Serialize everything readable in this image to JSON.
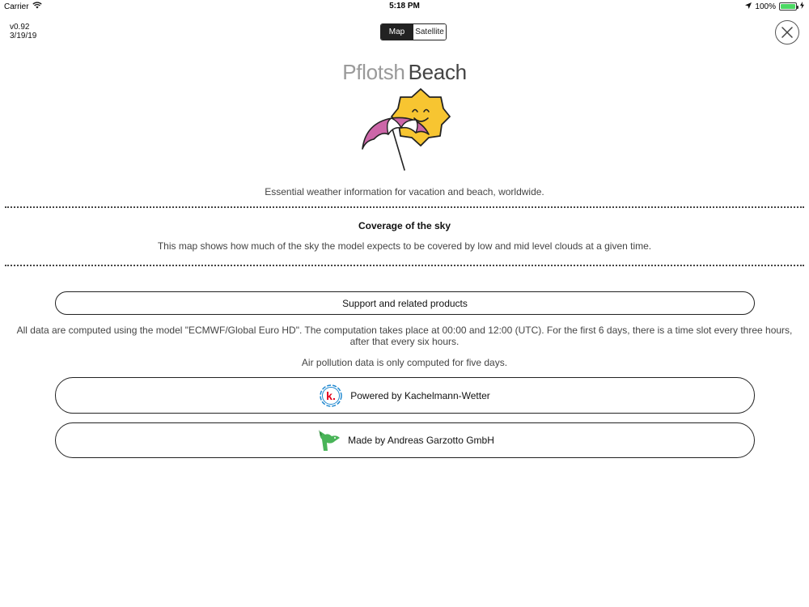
{
  "status_bar": {
    "carrier": "Carrier",
    "time": "5:18 PM",
    "battery": "100%",
    "battery_level": 1.0,
    "icons": [
      "wifi-icon",
      "location-arrow-icon",
      "battery-icon",
      "charging-bolt-icon"
    ]
  },
  "version": {
    "number": "v0.92",
    "date": "3/19/19"
  },
  "map_mode": {
    "options": [
      "Map",
      "Satellite"
    ],
    "selected": "Map"
  },
  "close_icon": "close-icon",
  "title": {
    "part1": "Pflotsh",
    "part2": "Beach"
  },
  "tagline": "Essential weather information for vacation and beach, worldwide.",
  "section": {
    "title": "Coverage of the sky",
    "description": "This map shows how much of the sky the model expects to be covered by low and mid level clouds at a given time."
  },
  "support_button": "Support and related products",
  "info_text": "All data are computed using the model \"ECMWF/Global Euro HD\". The computation takes place at 00:00 and 12:00 (UTC). For the first 6 days, there is a time slot every three hours, after that every six hours.",
  "pollution_text": "Air pollution data is only computed for five days.",
  "kachelmann_button": "Powered by Kachelmann-Wetter",
  "garzotto_button": "Made by Andreas Garzotto GmbH",
  "colors": {
    "sun": "#f7c531",
    "umbrella_pink": "#cc66a8",
    "kachelmann_red": "#e3001b",
    "kachelmann_blue": "#1e88d0",
    "garzotto_green": "#49b458",
    "battery_green": "#4cd964"
  }
}
